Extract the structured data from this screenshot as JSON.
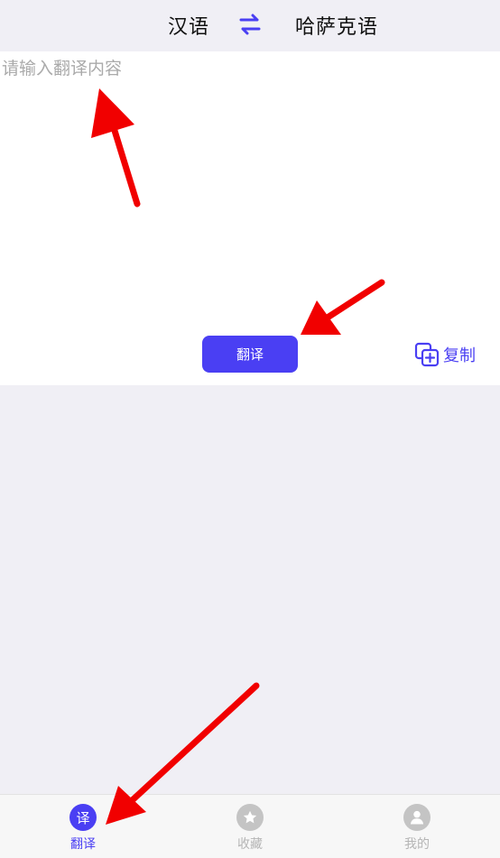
{
  "header": {
    "source_language": "汉语",
    "target_language": "哈萨克语"
  },
  "input": {
    "placeholder": "请输入翻译内容",
    "value": ""
  },
  "actions": {
    "translate_label": "翻译",
    "copy_label": "复制"
  },
  "tabbar": {
    "tabs": [
      {
        "label": "翻译",
        "icon_text": "译",
        "icon": "translate-icon",
        "active": true
      },
      {
        "label": "收藏",
        "icon": "star-icon",
        "active": false
      },
      {
        "label": "我的",
        "icon": "user-icon",
        "active": false
      }
    ]
  },
  "colors": {
    "accent": "#4a3ff3",
    "background": "#f0eff5",
    "panel": "#ffffff",
    "arrow": "#f10000"
  }
}
